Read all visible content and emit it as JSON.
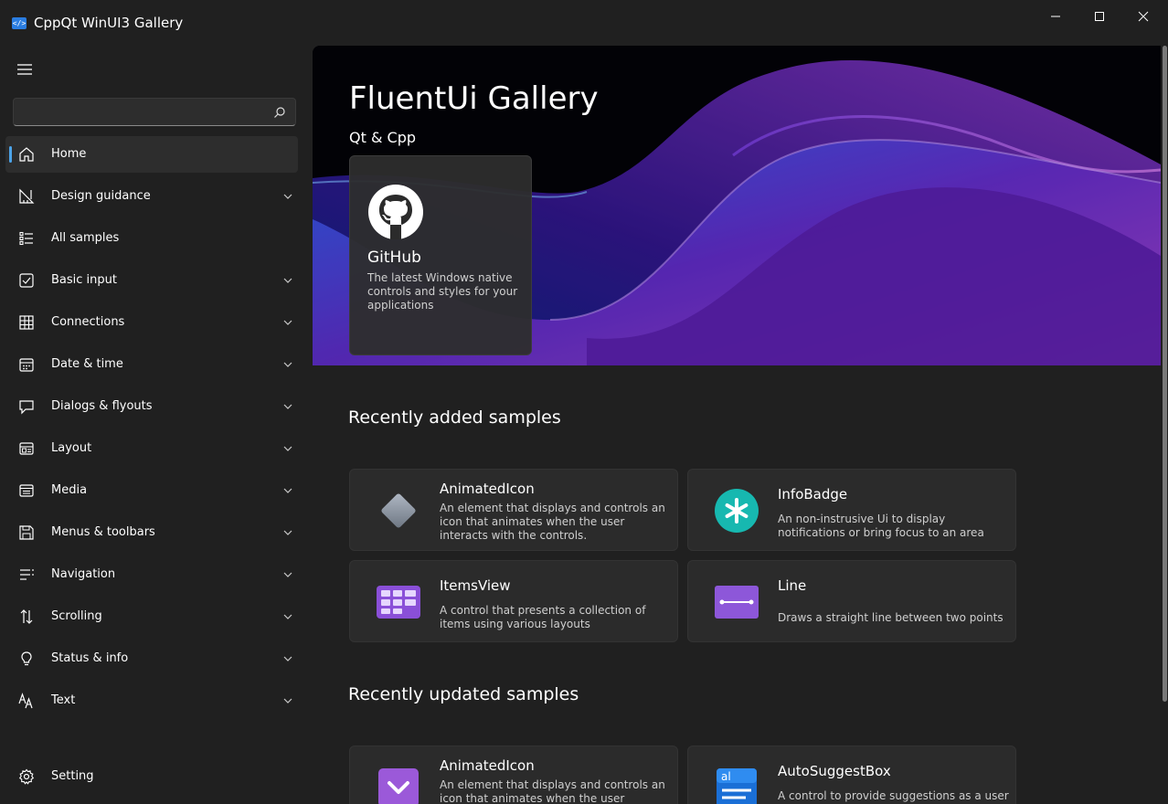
{
  "window": {
    "title": "CppQt WinUI3 Gallery",
    "app_icon": "code-icon"
  },
  "search": {
    "value": "",
    "placeholder": ""
  },
  "nav": {
    "items": [
      {
        "label": "Home",
        "icon": "home-icon",
        "expandable": false,
        "selected": true
      },
      {
        "label": "Design guidance",
        "icon": "ruler-icon",
        "expandable": true
      },
      {
        "label": "All samples",
        "icon": "list-icon",
        "expandable": false
      },
      {
        "label": "Basic input",
        "icon": "checkbox-icon",
        "expandable": true
      },
      {
        "label": "Connections",
        "icon": "grid-icon",
        "expandable": true
      },
      {
        "label": "Date & time",
        "icon": "calendar-icon",
        "expandable": true
      },
      {
        "label": "Dialogs & flyouts",
        "icon": "chat-icon",
        "expandable": true
      },
      {
        "label": "Layout",
        "icon": "layout-icon",
        "expandable": true
      },
      {
        "label": "Media",
        "icon": "media-icon",
        "expandable": true
      },
      {
        "label": "Menus & toolbars",
        "icon": "save-icon",
        "expandable": true
      },
      {
        "label": "Navigation",
        "icon": "navigation-icon",
        "expandable": true
      },
      {
        "label": "Scrolling",
        "icon": "scroll-icon",
        "expandable": true
      },
      {
        "label": "Status & info",
        "icon": "lightbulb-icon",
        "expandable": true
      },
      {
        "label": "Text",
        "icon": "text-icon",
        "expandable": true
      }
    ],
    "setting": {
      "label": "Setting",
      "icon": "gear-icon"
    }
  },
  "hero": {
    "title": "FluentUi Gallery",
    "subtitle": "Qt & Cpp",
    "card": {
      "title": "GitHub",
      "description": "The latest Windows native controls and styles for your applications",
      "icon": "github-icon"
    }
  },
  "recently_added": {
    "title": "Recently added samples",
    "cards": [
      {
        "title": "AnimatedIcon",
        "description": "An element that displays and controls an icon that animates when the user interacts with the controls.",
        "icon": "animated-icon-diamond"
      },
      {
        "title": "InfoBadge",
        "description": "An non-instrusive Ui to display notifications or bring focus to an area",
        "icon": "info-badge-icon"
      },
      {
        "title": "ItemsView",
        "description": "A control that presents a collection of items using various layouts",
        "icon": "items-view-icon"
      },
      {
        "title": "Line",
        "description": "Draws a straight line between two points",
        "icon": "line-icon"
      }
    ]
  },
  "recently_updated": {
    "title": "Recently updated samples",
    "cards": [
      {
        "title": "AnimatedIcon",
        "description": "An element that displays and controls an icon that animates when the user interacts",
        "icon": "animated-icon-check"
      },
      {
        "title": "AutoSuggestBox",
        "description": "A control to provide suggestions as a user",
        "icon": "autosuggest-icon"
      }
    ]
  },
  "colors": {
    "background": "#202020",
    "card": "#2b2b2b",
    "accent": "#4ca3e8",
    "hero_purple": "#8a3cd6",
    "hero_blue": "#1e4fd8"
  }
}
